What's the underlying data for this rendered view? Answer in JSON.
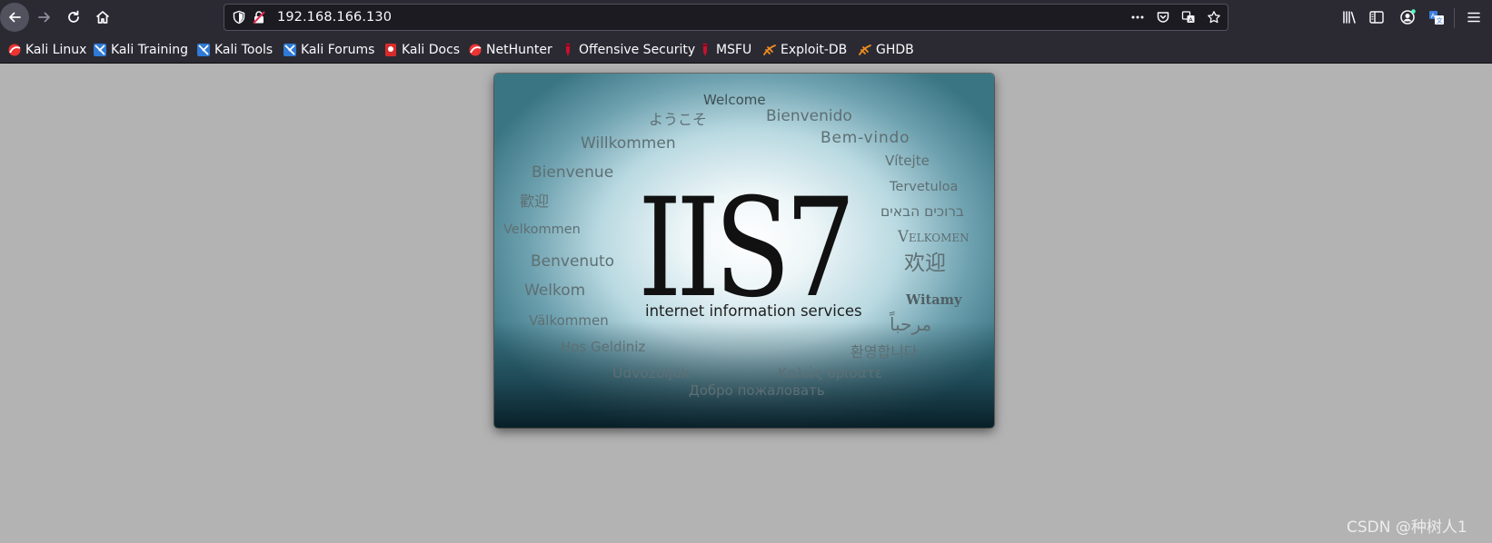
{
  "browser": {
    "url": "192.168.166.130",
    "colors": {
      "toolbar": "#2b2a33",
      "urlbar": "#1c1b22",
      "page_bg": "#b3b3b3"
    },
    "nav_icons": [
      "back-icon",
      "forward-icon",
      "reload-icon",
      "home-icon"
    ],
    "urlbar_icons": [
      "shield-icon",
      "insecure-lock-icon",
      "more-actions-icon",
      "pocket-icon",
      "translate-icon",
      "bookmark-star-icon"
    ],
    "right_icons": [
      "library-icon",
      "sidebar-icon",
      "account-icon",
      "translate-icon",
      "menu-icon"
    ]
  },
  "bookmarks": [
    {
      "label": "Kali Linux",
      "icon": "kali-dragon-icon"
    },
    {
      "label": "Kali Training",
      "icon": "kali-training-icon"
    },
    {
      "label": "Kali Tools",
      "icon": "kali-tools-icon"
    },
    {
      "label": "Kali Forums",
      "icon": "kali-forums-icon"
    },
    {
      "label": "Kali Docs",
      "icon": "kali-docs-icon"
    },
    {
      "label": "NetHunter",
      "icon": "nethunter-icon"
    },
    {
      "label": "Offensive Security",
      "icon": "offsec-icon"
    },
    {
      "label": "MSFU",
      "icon": "msfu-icon"
    },
    {
      "label": "Exploit-DB",
      "icon": "exploit-db-icon"
    },
    {
      "label": "GHDB",
      "icon": "ghdb-icon"
    }
  ],
  "iis": {
    "logo": "IIS7",
    "tagline": "internet information services",
    "welcome_words": [
      "Welcome",
      "ようこそ",
      "Bienvenido",
      "Willkommen",
      "Bem-vindo",
      "Vítejte",
      "Bienvenue",
      "Tervetuloa",
      "歡迎",
      "ברוכים הבאים",
      "Velkommen",
      "Velkomen",
      "Benvenuto",
      "欢迎",
      "Welkom",
      "Witamy",
      "Välkommen",
      "مرحباً",
      "Hoş Geldiniz",
      "환영합니다",
      "Üdvözöljük",
      "Καλώς ορίσατε",
      "Добро пожаловать"
    ]
  },
  "watermark": "CSDN @种树人1"
}
